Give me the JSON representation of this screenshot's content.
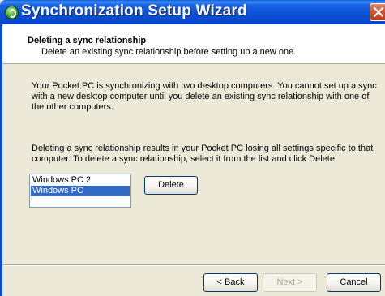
{
  "window": {
    "title": "Synchronization Setup Wizard"
  },
  "header": {
    "title": "Deleting a sync relationship",
    "subtitle": "Delete an existing sync relationship before setting up a new one."
  },
  "body": {
    "paragraph1": "Your Pocket PC is synchronizing with two desktop computers.  You cannot set up a sync with a new desktop computer until you delete an existing sync relationship with one of the other computers.",
    "paragraph2": "Deleting a sync relationship results in your Pocket PC losing all settings specific to that computer.  To delete a sync relationship, select it from the list and click Delete."
  },
  "partnerships": {
    "items": [
      {
        "label": "Windows PC 2",
        "selected": false
      },
      {
        "label": "Windows PC",
        "selected": true
      }
    ],
    "delete_label": "Delete"
  },
  "footer": {
    "back_label": "< Back",
    "next_label": "Next >",
    "cancel_label": "Cancel"
  },
  "colors": {
    "titlebar": "#0a4ad0",
    "selection": "#316ac5",
    "dialog_face": "#ece9d8",
    "close_button": "#d9502c"
  },
  "icons": {
    "app": "sync-icon",
    "close": "close-icon"
  }
}
